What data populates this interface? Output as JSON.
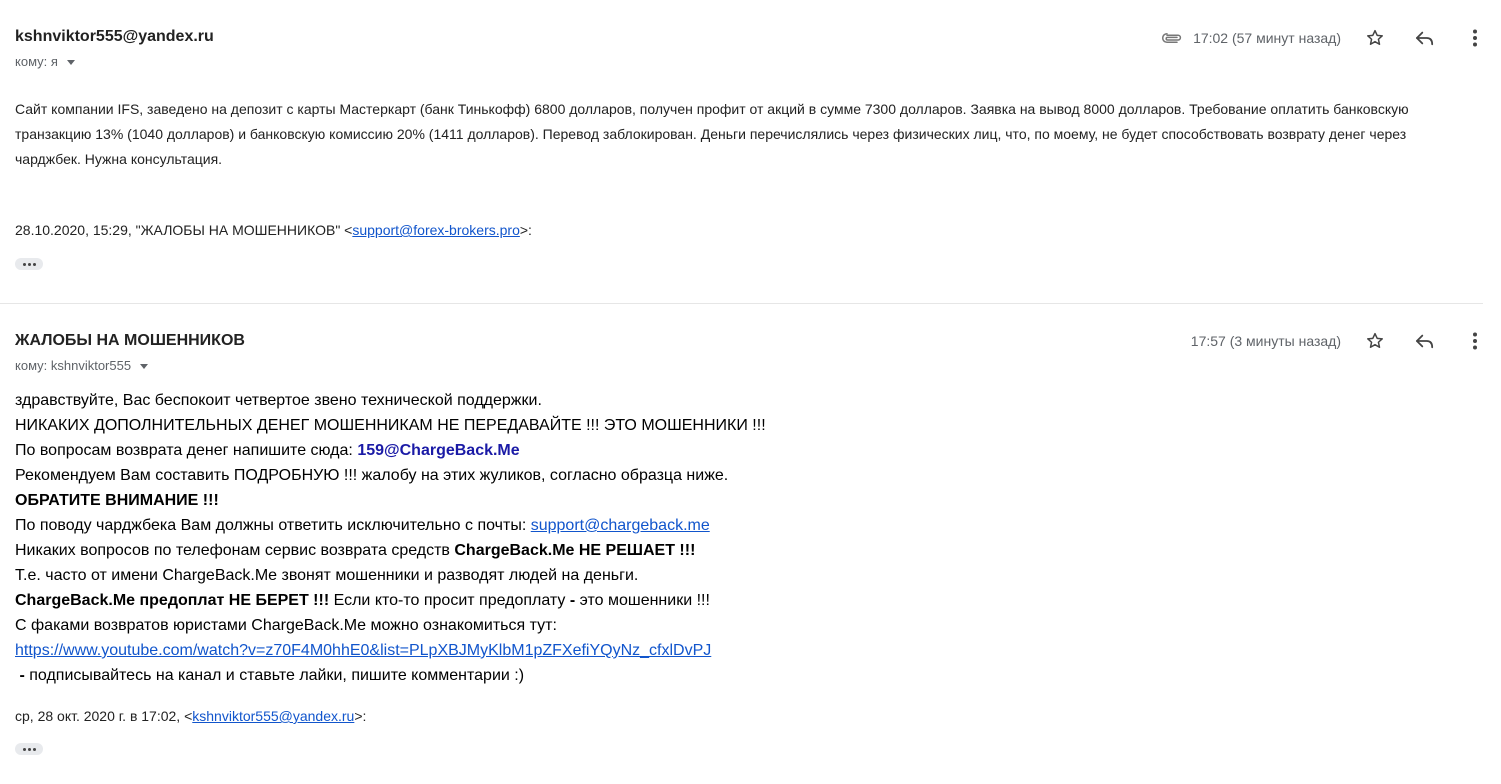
{
  "messages": [
    {
      "sender": "kshnviktor555@yandex.ru",
      "recipient_label": "кому: я",
      "time": "17:02 (57 минут назад)",
      "has_attachment": true,
      "body": "Сайт компании IFS, заведено на депозит с карты Мастеркарт (банк Тинькофф) 6800 долларов, получен профит от акций в сумме 7300 долларов. Заявка на вывод 8000 долларов. Требование оплатить банковскую транзакцию 13% (1040 долларов) и банковскую комиссию 20% (1411 долларов). Перевод заблокирован. Деньги перечислялись через физических лиц, что, по моему, не будет способствовать возврату денег через чарджбек. Нужна консультация.",
      "quote_prefix": "28.10.2020, 15:29, \"ЖАЛОБЫ НА МОШЕННИКОВ\" <",
      "quote_email": "support@forex-brokers.pro",
      "quote_suffix": ">:"
    },
    {
      "sender": "ЖАЛОБЫ НА МОШЕННИКОВ",
      "recipient_label": "кому: kshnviktor555",
      "time": "17:57 (3 минуты назад)",
      "has_attachment": false,
      "lines": {
        "l1": "здравствуйте, Вас беспокоит четвертое звено технической поддержки.",
        "l2": "НИКАКИХ ДОПОЛНИТЕЛЬНЫХ ДЕНЕГ МОШЕННИКАМ НЕ ПЕРЕДАВАЙТЕ !!! ЭТО МОШЕННИКИ !!!",
        "l3_text": "По вопросам возврата денег напишите сюда: ",
        "l3_email": "159@ChargeBack.Me",
        "l4": "Рекомендуем Вам составить ПОДРОБНУЮ !!! жалобу на этих жуликов, согласно образца ниже.",
        "l5": "ОБРАТИТЕ ВНИМАНИЕ !!!",
        "l6_text": "По поводу чарджбека Вам должны ответить исключительно с почты: ",
        "l6_link": "support@chargeback.me",
        "l7_text": "Никаких вопросов по телефонам сервис возврата средств ",
        "l7_bold": "ChargeBack.Me НЕ РЕШАЕТ !!!",
        "l8": "Т.е. часто от имени ChargeBack.Me звонят мошенники и разводят людей на деньги.",
        "l9_bold1": "ChargeBack.Me предоплат НЕ БЕРЕТ !!!",
        "l9_text": " Если кто-то просит предоплату ",
        "l9_bold2": "-",
        "l9_text2": " это мошенники !!!",
        "l10": "С факами возвратов юристами ChargeBack.Me можно ознакомиться тут:",
        "l11_link": "https://www.youtube.com/watch?v=z70F4M0hhE0&list=PLpXBJMyKlbM1pZFXefiYQyNz_cfxlDvPJ",
        "l12_bold": " -",
        "l12_text": " подписывайтесь на канал и ставьте лайки, пишите комментарии :)"
      },
      "quote_prefix": "ср, 28 окт. 2020 г. в 17:02, <",
      "quote_email": "kshnviktor555@yandex.ru",
      "quote_suffix": ">:"
    }
  ],
  "icons": {
    "attachment": "paperclip-icon",
    "star": "star-icon",
    "reply": "reply-icon",
    "more": "more-vert-icon",
    "expand": "ellipsis-icon"
  },
  "colors": {
    "link": "#1155cc",
    "secondary_text": "#5f6368",
    "email_highlight": "#1a1aa6"
  }
}
